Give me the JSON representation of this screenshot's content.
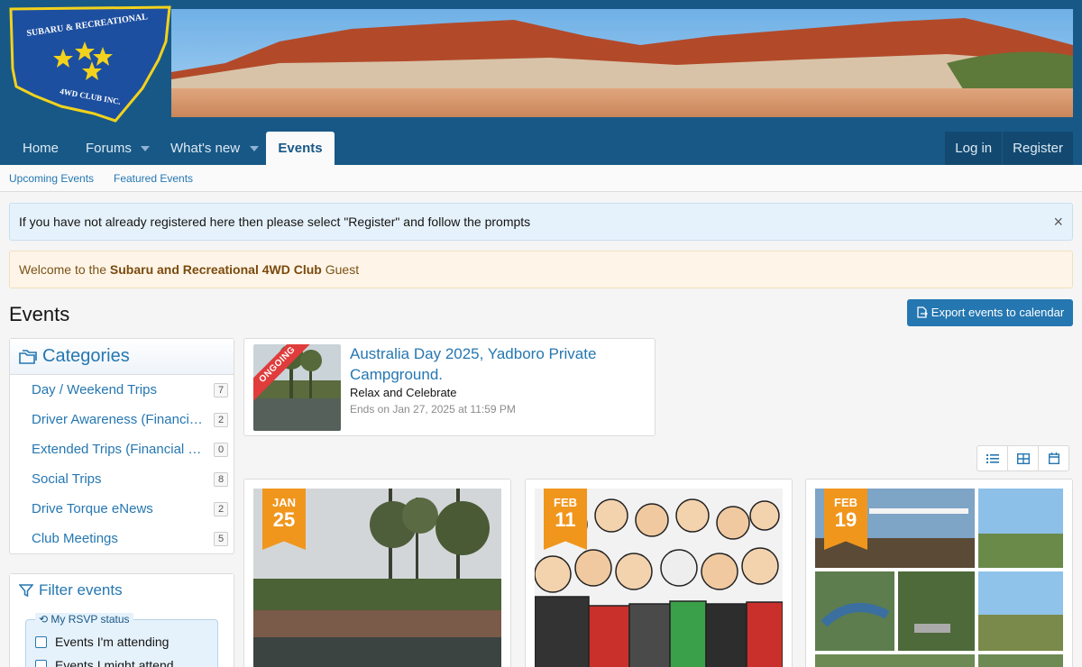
{
  "logo": {
    "text_top": "SUBARU & RECREATIONAL",
    "text_bottom": "4WD CLUB INC."
  },
  "nav": {
    "home": "Home",
    "forums": "Forums",
    "whats_new": "What's new",
    "events": "Events",
    "login": "Log in",
    "register": "Register"
  },
  "subnav": {
    "upcoming": "Upcoming Events",
    "featured": "Featured Events"
  },
  "notices": {
    "info": "If you have not already registered here then please select \"Register\" and follow the prompts",
    "close": "×",
    "welcome_pre": "Welcome to the",
    "welcome_bold": "Subaru and Recreational 4WD Club",
    "welcome_post": "Guest"
  },
  "page": {
    "title": "Events",
    "export_label": "Export events to calendar"
  },
  "categories": {
    "title": "Categories",
    "items": [
      {
        "label": "Day / Weekend Trips",
        "count": "7"
      },
      {
        "label": "Driver Awareness (Financial Members Only)",
        "count": "2"
      },
      {
        "label": "Extended Trips (Financial Club Members Only)",
        "count": "0"
      },
      {
        "label": "Social Trips",
        "count": "8"
      },
      {
        "label": "Drive Torque eNews",
        "count": "2"
      },
      {
        "label": "Club Meetings",
        "count": "5"
      }
    ]
  },
  "filter": {
    "title": "Filter events",
    "rsvp_legend": "My RSVP status",
    "options": [
      "Events I'm attending",
      "Events I might attend"
    ]
  },
  "featured_event": {
    "ribbon": "ONGOING",
    "title": "Australia Day 2025, Yadboro Private Campground.",
    "subtitle": "Relax and Celebrate",
    "ends": "Ends on Jan 27, 2025 at 11:59 PM"
  },
  "cards": [
    {
      "month": "JAN",
      "day": "25"
    },
    {
      "month": "FEB",
      "day": "11"
    },
    {
      "month": "FEB",
      "day": "19"
    }
  ],
  "colors": {
    "header": "#185886",
    "link": "#2577b1",
    "badge": "#f0961c",
    "ribbon": "#e03c3c"
  }
}
